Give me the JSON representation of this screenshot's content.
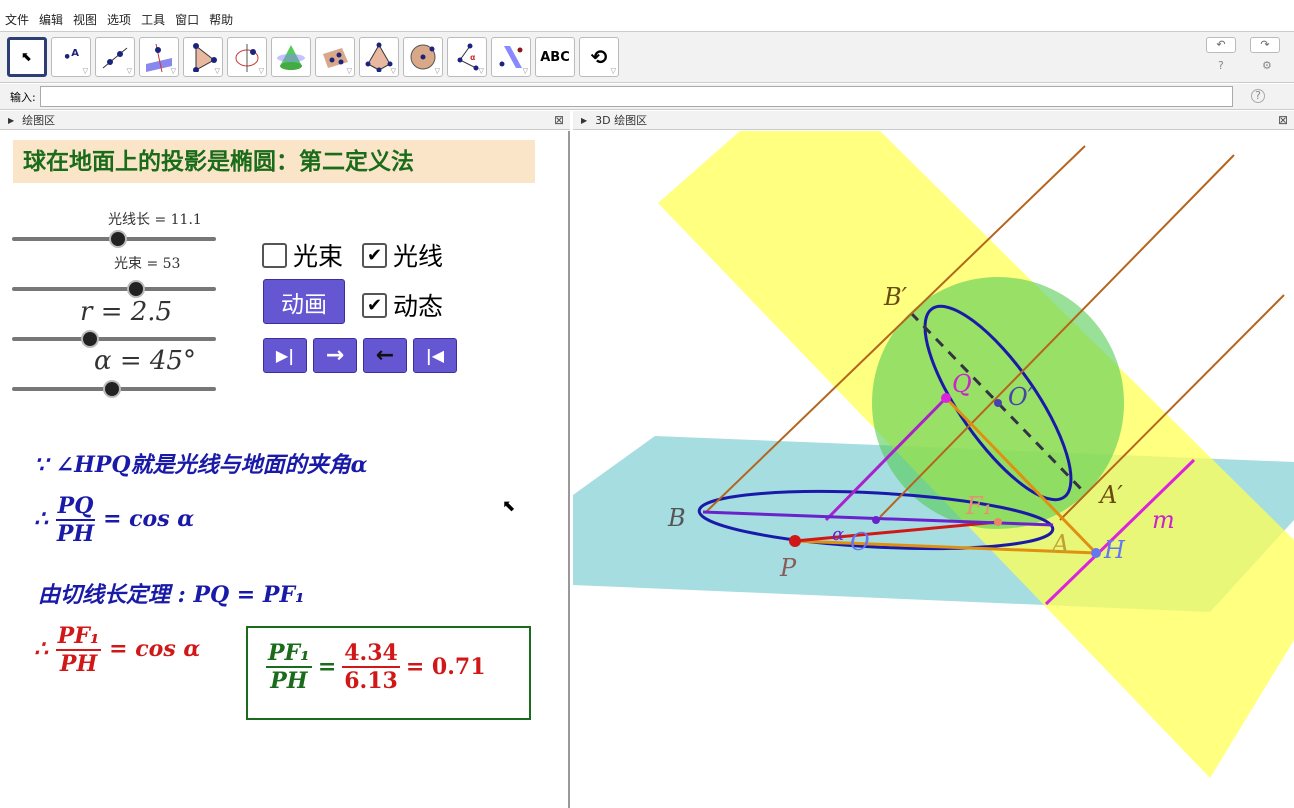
{
  "menu": [
    "文件",
    "编辑",
    "视图",
    "选项",
    "工具",
    "窗口",
    "帮助"
  ],
  "toolbar": {
    "tools": [
      "move",
      "point",
      "line",
      "perpendicular",
      "polygon",
      "circle-axis",
      "cone",
      "plane-points",
      "pyramid",
      "sphere",
      "angle",
      "reflect",
      "text",
      "rotate-view"
    ],
    "text_tool_label": "ABC",
    "undo": "↶",
    "redo": "↷",
    "help": "?",
    "settings": "⚙"
  },
  "input": {
    "label": "输入:",
    "value": ""
  },
  "panels": {
    "left_title": "绘图区",
    "right_title": "3D 绘图区"
  },
  "left": {
    "heading": "球在地面上的投影是椭圆：第二定义法",
    "sliders": [
      {
        "label": "光线长 = 11.1",
        "fraction": 0.52
      },
      {
        "label": "光束 = 53",
        "fraction": 0.61
      },
      {
        "label": "r = 2.5",
        "fraction": 0.38
      },
      {
        "label": "α = 45°",
        "fraction": 0.49
      }
    ],
    "checkboxes": [
      {
        "label": "光束",
        "checked": false
      },
      {
        "label": "光线",
        "checked": true
      },
      {
        "label": "动态",
        "checked": true
      }
    ],
    "animate_button": "动画",
    "nav_buttons": [
      "▶|",
      "→",
      "←",
      "|◀"
    ],
    "lines": {
      "l1_prefix": "∵ ∠HPQ",
      "l1_text": "就是光线与地面的夹角α",
      "l2_prefix": "∴",
      "l2_num": "PQ",
      "l2_den": "PH",
      "l2_rhs": "= cos α",
      "l3_text": "由切线长定理 : PQ = PF₁",
      "l4_prefix": "∴",
      "l4_num": "PF₁",
      "l4_den": "PH",
      "l4_rhs": "= cos α",
      "box_num": "PF₁",
      "box_den": "PH",
      "box_eq": "=",
      "box_vnum": "4.34",
      "box_vden": "6.13",
      "box_result": "= 0.71"
    }
  },
  "scene": {
    "labels": {
      "Bp": "B′",
      "Q": "Q",
      "Op": "O′",
      "Ap": "A′",
      "B": "B",
      "F1": "F₁",
      "A": "A",
      "H": "H",
      "m": "m",
      "P": "P",
      "alpha": "α",
      "O": "O"
    }
  },
  "colors": {
    "accent": "#6557d2",
    "heading_bg": "#fbe5c8",
    "heading": "#1a6b1a",
    "blue_text": "#1a1aa8",
    "red_text": "#d01818"
  }
}
